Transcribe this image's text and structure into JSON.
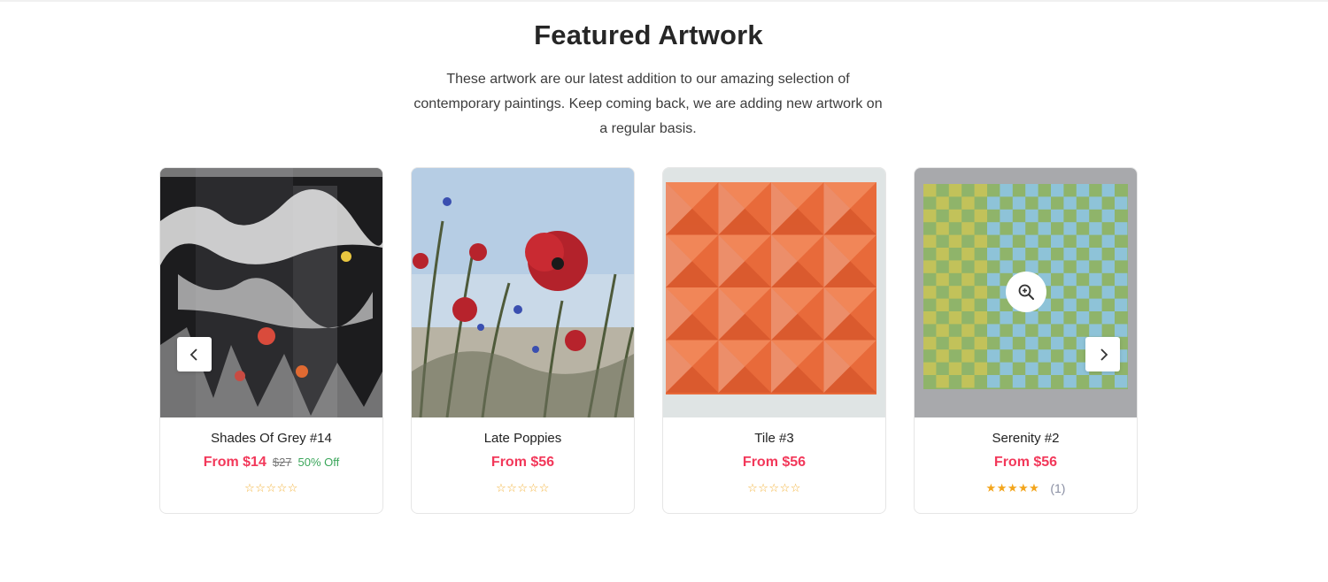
{
  "section": {
    "title": "Featured Artwork",
    "subtitle": "These artwork are our latest addition to our amazing selection of contemporary paintings. Keep coming back, we are adding new artwork on a regular basis."
  },
  "products": [
    {
      "name": "Shades Of Grey #14",
      "price": "From $14",
      "old_price": "$27",
      "discount": "50% Off",
      "rating": 0,
      "stars": "☆☆☆☆☆",
      "reviews": ""
    },
    {
      "name": "Late Poppies",
      "price": "From $56",
      "old_price": "",
      "discount": "",
      "rating": 0,
      "stars": "☆☆☆☆☆",
      "reviews": ""
    },
    {
      "name": "Tile #3",
      "price": "From $56",
      "old_price": "",
      "discount": "",
      "rating": 0,
      "stars": "☆☆☆☆☆",
      "reviews": ""
    },
    {
      "name": "Serenity #2",
      "price": "From $56",
      "old_price": "",
      "discount": "",
      "rating": 5,
      "stars": "★★★★★",
      "reviews": "(1)"
    }
  ],
  "controls": {
    "prev_icon": "chevron-left-icon",
    "next_icon": "chevron-right-icon",
    "zoom_icon": "zoom-in-icon"
  },
  "colors": {
    "price": "#f2385a",
    "discount": "#3aa65a",
    "star": "#f3a51c"
  }
}
